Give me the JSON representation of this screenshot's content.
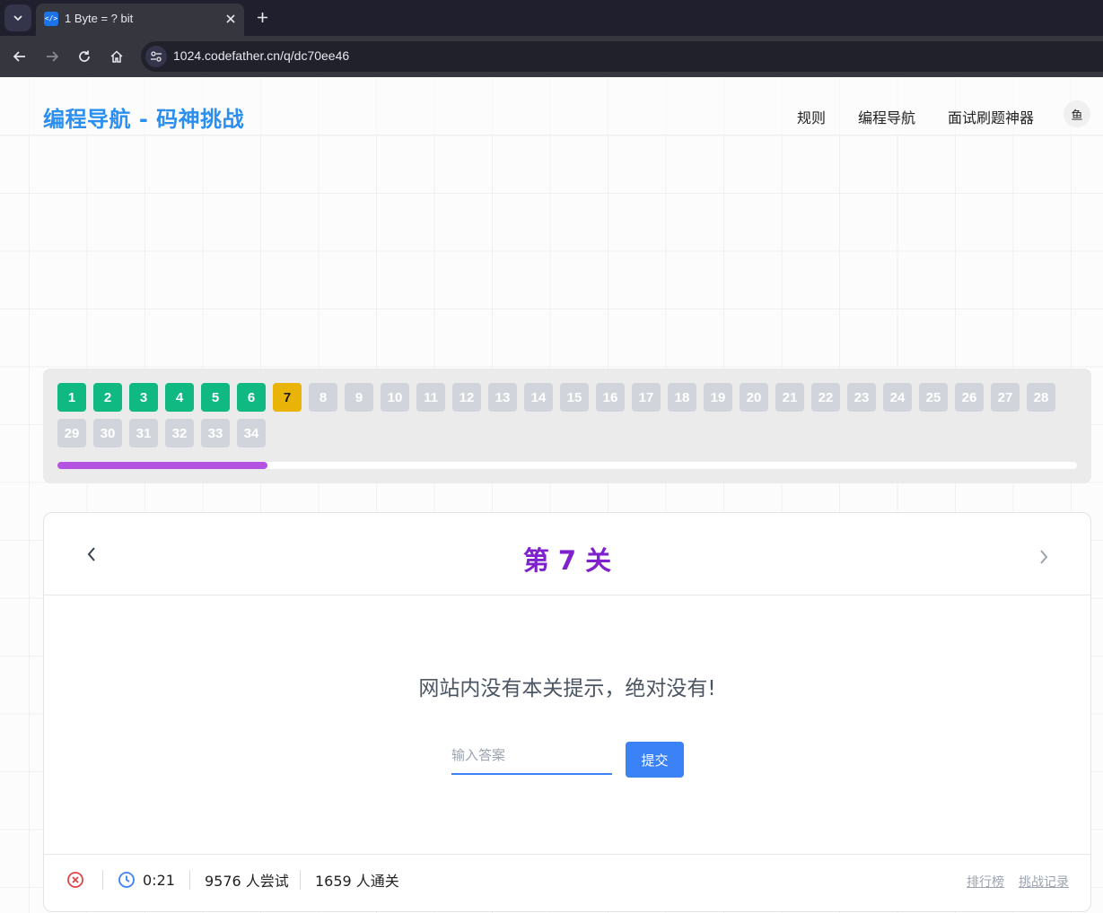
{
  "browser": {
    "tab_title": "1 Byte = ? bit",
    "url": "1024.codefather.cn/q/dc70ee46"
  },
  "header": {
    "site_title": "编程导航 - 码神挑战",
    "nav": [
      "规则",
      "编程导航",
      "面试刷题神器"
    ],
    "avatar_text": "鱼"
  },
  "levels": {
    "items": [
      {
        "label": "1",
        "status": "done"
      },
      {
        "label": "2",
        "status": "done"
      },
      {
        "label": "3",
        "status": "done"
      },
      {
        "label": "4",
        "status": "done"
      },
      {
        "label": "5",
        "status": "done"
      },
      {
        "label": "6",
        "status": "done"
      },
      {
        "label": "7",
        "status": "current"
      },
      {
        "label": "8",
        "status": "locked"
      },
      {
        "label": "9",
        "status": "locked"
      },
      {
        "label": "10",
        "status": "locked"
      },
      {
        "label": "11",
        "status": "locked"
      },
      {
        "label": "12",
        "status": "locked"
      },
      {
        "label": "13",
        "status": "locked"
      },
      {
        "label": "14",
        "status": "locked"
      },
      {
        "label": "15",
        "status": "locked"
      },
      {
        "label": "16",
        "status": "locked"
      },
      {
        "label": "17",
        "status": "locked"
      },
      {
        "label": "18",
        "status": "locked"
      },
      {
        "label": "19",
        "status": "locked"
      },
      {
        "label": "20",
        "status": "locked"
      },
      {
        "label": "21",
        "status": "locked"
      },
      {
        "label": "22",
        "status": "locked"
      },
      {
        "label": "23",
        "status": "locked"
      },
      {
        "label": "24",
        "status": "locked"
      },
      {
        "label": "25",
        "status": "locked"
      },
      {
        "label": "26",
        "status": "locked"
      },
      {
        "label": "27",
        "status": "locked"
      },
      {
        "label": "28",
        "status": "locked"
      },
      {
        "label": "29",
        "status": "locked"
      },
      {
        "label": "30",
        "status": "locked"
      },
      {
        "label": "31",
        "status": "locked"
      },
      {
        "label": "32",
        "status": "locked"
      },
      {
        "label": "33",
        "status": "locked"
      },
      {
        "label": "34",
        "status": "locked"
      }
    ],
    "progress_fraction": 0.206
  },
  "challenge": {
    "title": "第 7 关",
    "question": "网站内没有本关提示，绝对没有!",
    "answer_placeholder": "输入答案",
    "answer_value": "",
    "submit_label": "提交"
  },
  "footer": {
    "timer": "0:21",
    "attempts": "9576 人尝试",
    "passed": "1659 人通关",
    "leaderboard_link": "排行榜",
    "history_link": "挑战记录"
  },
  "colors": {
    "brand": "#2a8ff0",
    "level_done": "#10b981",
    "level_current": "#eab308",
    "level_locked": "#d1d5db",
    "progress": "#b452e2",
    "title_purple": "#7e22ce",
    "primary_button": "#3b82f6"
  }
}
